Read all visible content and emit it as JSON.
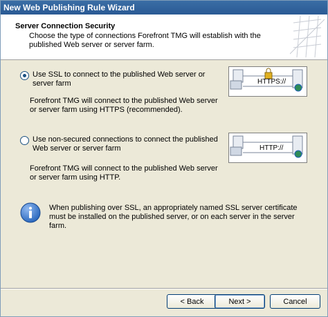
{
  "window": {
    "title": "New Web Publishing Rule Wizard"
  },
  "header": {
    "title": "Server Connection Security",
    "subtitle": "Choose the type of connections Forefront TMG will establish with the published Web server or server farm."
  },
  "options": [
    {
      "label": "Use SSL to connect to the published Web server or server farm",
      "description": "Forefront TMG will connect to the published Web server or server farm using HTTPS (recommended).",
      "checked": true,
      "diagram_text": "HTTPS://"
    },
    {
      "label": "Use non-secured connections to connect the published Web server or server farm",
      "description": "Forefront TMG will connect to the published Web server or server farm using HTTP.",
      "checked": false,
      "diagram_text": "HTTP://"
    }
  ],
  "info": {
    "text": "When publishing over SSL, an appropriately named SSL server certificate must be installed on the published server, or on each server in the server farm."
  },
  "buttons": {
    "back": "< Back",
    "next": "Next >",
    "cancel": "Cancel"
  },
  "colors": {
    "titlebar": "#2a5a94",
    "accent": "#1c5180",
    "info_icon": "#1f5fb8"
  }
}
